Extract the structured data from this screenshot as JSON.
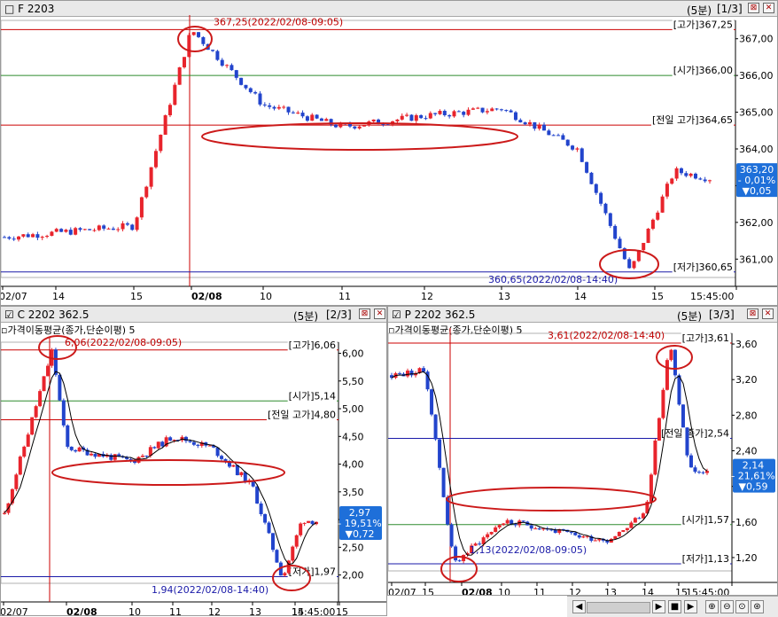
{
  "panels": [
    {
      "id": "f",
      "title": "F 2203",
      "interval": "(5분)",
      "page": "[1/3]",
      "ylim": [
        360.5,
        367.5
      ],
      "yticks": [
        "367,00",
        "366,00",
        "365,00",
        "364,00",
        "363,00",
        "362,00",
        "361,00"
      ],
      "ytick_values": [
        367,
        366,
        365,
        364,
        363,
        362,
        361
      ],
      "xticks": [
        "02/07",
        "14",
        "15",
        "02/08",
        "10",
        "11",
        "12",
        "13",
        "14",
        "15",
        "15:45:00"
      ],
      "price_lines": [
        {
          "label": "[고가]367,25",
          "value": 367.25,
          "color": "#cc0000"
        },
        {
          "label": "[시가]366,00",
          "value": 366.0,
          "color": "#2e8b2e"
        },
        {
          "label": "[전일 고가]364,65",
          "value": 364.65,
          "color": "#cc0000"
        },
        {
          "label": "[저가]360,65",
          "value": 360.65,
          "color": "#1a1aa8"
        }
      ],
      "high_note": "367,25(2022/02/08-09:05)",
      "low_note": "360,65(2022/02/08-14:40)",
      "current": {
        "price": "363,20",
        "pct": "- 0,01%",
        "chg": "▼0,05",
        "value": 363.2
      },
      "chart_data": {
        "type": "line",
        "title": "F 2203",
        "x": [
          "02/07 14:00",
          "02/07 15:00",
          "02/08 09:05",
          "02/08 10:00",
          "02/08 11:00",
          "02/08 12:00",
          "02/08 13:00",
          "02/08 14:00",
          "02/08 14:40",
          "02/08 15:00",
          "02/08 15:45"
        ],
        "series": [
          {
            "values": [
              361.6,
              361.9,
              367.25,
              365.2,
              364.6,
              364.9,
              365.1,
              364.0,
              360.65,
              363.4,
              363.2
            ]
          }
        ],
        "ylim": [
          360.5,
          367.5
        ]
      }
    },
    {
      "id": "c",
      "title": "C 2202 362.5",
      "interval": "(5분)",
      "page": "[2/3]",
      "indicator": "가격이동평균(종가,단순이평) 5",
      "ylim": [
        1.85,
        6.2
      ],
      "yticks": [
        "6,00",
        "5,50",
        "5,00",
        "4,50",
        "4,00",
        "3,50",
        "3,00",
        "2,50",
        "2,00"
      ],
      "ytick_values": [
        6,
        5.5,
        5,
        4.5,
        4,
        3.5,
        3,
        2.5,
        2
      ],
      "xticks": [
        "02/07",
        "02/08",
        "10",
        "11",
        "12",
        "13",
        "14",
        "15",
        "15:45:00"
      ],
      "price_lines": [
        {
          "label": "[고가]6,06",
          "value": 6.06,
          "color": "#cc0000"
        },
        {
          "label": "[시가]5,14",
          "value": 5.14,
          "color": "#2e8b2e"
        },
        {
          "label": "[전일 고가]4,80",
          "value": 4.8,
          "color": "#cc0000"
        },
        {
          "label": "[저가]1,97",
          "value": 1.97,
          "color": "#1a1aa8"
        }
      ],
      "high_note": "6,06(2022/02/08-09:05)",
      "low_note": "1,94(2022/02/08-14:40)",
      "current": {
        "price": "2,97",
        "pct": "- 19,51%",
        "chg": "▼0,72",
        "value": 2.97
      },
      "chart_data": {
        "type": "line",
        "title": "C 2202 362.5",
        "x": [
          "02/07",
          "02/08 09:05",
          "02/08 10:00",
          "02/08 11:00",
          "02/08 12:00",
          "02/08 13:00",
          "02/08 14:00",
          "02/08 14:40",
          "02/08 15:00",
          "02/08 15:45"
        ],
        "series": [
          {
            "values": [
              3.1,
              6.06,
              4.3,
              4.05,
              4.5,
              4.3,
              3.6,
              1.94,
              3.0,
              2.97
            ]
          }
        ],
        "ylim": [
          1.85,
          6.2
        ]
      }
    },
    {
      "id": "p",
      "title": "P 2202 362.5",
      "interval": "(5분)",
      "page": "[3/3]",
      "indicator": "가격이동평균(종가,단순이평) 5",
      "ylim": [
        1.05,
        3.72
      ],
      "yticks": [
        "3,60",
        "3,20",
        "2,80",
        "2,40",
        "2,00",
        "1,60",
        "1,20"
      ],
      "ytick_values": [
        3.6,
        3.2,
        2.8,
        2.4,
        2.0,
        1.6,
        1.2
      ],
      "xticks": [
        "02/07",
        "15",
        "02/08",
        "10",
        "11",
        "12",
        "13",
        "14",
        "15",
        "15:45:00"
      ],
      "price_lines": [
        {
          "label": "[고가]3,61",
          "value": 3.61,
          "color": "#cc0000"
        },
        {
          "label": "[전일 종가]2,54",
          "value": 2.54,
          "color": "#1a1aa8"
        },
        {
          "label": "[시가]1,57",
          "value": 1.57,
          "color": "#2e8b2e"
        },
        {
          "label": "[저가]1,13",
          "value": 1.13,
          "color": "#1a1aa8"
        }
      ],
      "high_note": "3,61(2022/02/08-14:40)",
      "low_note": "1,13(2022/02/08-09:05)",
      "current": {
        "price": "2,14",
        "pct": "- 21,61%",
        "chg": "▼0,59",
        "value": 2.14
      },
      "chart_data": {
        "type": "line",
        "title": "P 2202 362.5",
        "x": [
          "02/07",
          "02/07 15:00",
          "02/08 09:05",
          "02/08 10:00",
          "02/08 11:00",
          "02/08 12:00",
          "02/08 13:00",
          "02/08 14:00",
          "02/08 14:40",
          "02/08 15:00",
          "02/08 15:45"
        ],
        "series": [
          {
            "values": [
              3.25,
              3.3,
              1.13,
              1.6,
              1.55,
              1.45,
              1.4,
              1.7,
              3.61,
              2.2,
              2.14
            ]
          }
        ],
        "ylim": [
          1.05,
          3.72
        ]
      }
    }
  ],
  "colors": {
    "up": "#e8242c",
    "down": "#2244cc",
    "ma": "#000000",
    "ellipse": "#cc1a1a"
  }
}
